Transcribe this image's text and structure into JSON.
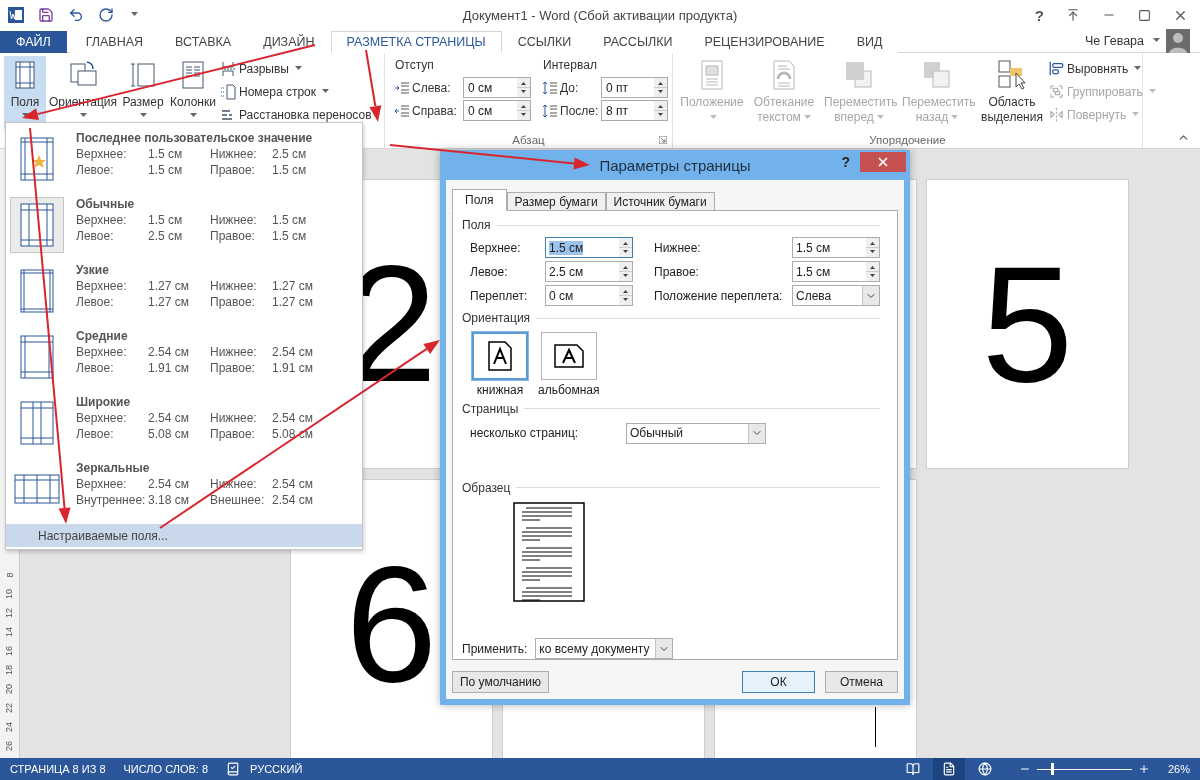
{
  "title_bar": {
    "title": "Документ1 - Word (Сбой активации продукта)",
    "help": "?"
  },
  "tabs": [
    {
      "label": "ФАЙЛ",
      "kind": "file",
      "selected": false
    },
    {
      "label": "ГЛАВНАЯ",
      "kind": "tab",
      "selected": false
    },
    {
      "label": "ВСТАВКА",
      "kind": "tab",
      "selected": false
    },
    {
      "label": "ДИЗАЙН",
      "kind": "tab",
      "selected": false
    },
    {
      "label": "РАЗМЕТКА СТРАНИЦЫ",
      "kind": "tab",
      "selected": true
    },
    {
      "label": "ССЫЛКИ",
      "kind": "tab",
      "selected": false
    },
    {
      "label": "РАССЫЛКИ",
      "kind": "tab",
      "selected": false
    },
    {
      "label": "РЕЦЕНЗИРОВАНИЕ",
      "kind": "tab",
      "selected": false
    },
    {
      "label": "ВИД",
      "kind": "tab",
      "selected": false
    }
  ],
  "user": {
    "name": "Че Гевара"
  },
  "ribbon": {
    "page_setup": {
      "buttons": [
        {
          "label": "Поля",
          "kind": "margins",
          "selected": true
        },
        {
          "label": "Ориентация",
          "kind": "orientation",
          "selected": false
        },
        {
          "label": "Размер",
          "kind": "size",
          "selected": false
        },
        {
          "label": "Колонки",
          "kind": "columns",
          "selected": false
        }
      ],
      "small_buttons": [
        {
          "label": "Разрывы",
          "kind": "breaks",
          "dropdown": true
        },
        {
          "label": "Номера строк",
          "kind": "line_numbers",
          "dropdown": true
        },
        {
          "label": "Расстановка переносов",
          "kind": "hyphenation",
          "dropdown": false
        }
      ]
    },
    "paragraph": {
      "indent_title": "Отступ",
      "spacing_title": "Интервал",
      "indent": [
        {
          "label": "Слева:",
          "value": "0 см"
        },
        {
          "label": "Справа:",
          "value": "0 см"
        }
      ],
      "spacing": [
        {
          "label": "До:",
          "value": "0 пт"
        },
        {
          "label": "После:",
          "value": "8 пт"
        }
      ],
      "group_label": "Абзац"
    },
    "arrange": {
      "buttons": [
        {
          "label": "Положение",
          "kind": "position",
          "disabled": true,
          "dropdown": true
        },
        {
          "label": "Обтекание текстом",
          "kind": "wrap",
          "disabled": true,
          "dropdown": true
        },
        {
          "label": "Переместить вперед",
          "kind": "forward",
          "disabled": true,
          "dropdown": true
        },
        {
          "label": "Переместить назад",
          "kind": "backward",
          "disabled": true,
          "dropdown": true
        },
        {
          "label": "Область выделения",
          "kind": "selection_pane",
          "disabled": false,
          "dropdown": false
        }
      ],
      "small_buttons": [
        {
          "label": "Выровнять",
          "kind": "align",
          "disabled": false
        },
        {
          "label": "Группировать",
          "kind": "group",
          "disabled": true
        },
        {
          "label": "Повернуть",
          "kind": "rotate",
          "disabled": true
        }
      ],
      "group_label": "Упорядочение"
    }
  },
  "document": {
    "ruler_numbers": [
      "8",
      "10",
      "12",
      "14",
      "16",
      "18",
      "20",
      "22",
      "24",
      "26"
    ],
    "pages": [
      {
        "kind": "numbered",
        "number": "2"
      },
      {
        "kind": "blank"
      },
      {
        "kind": "numbered",
        "number": "5"
      },
      {
        "kind": "numbered",
        "number": "6"
      },
      {
        "kind": "blank"
      },
      {
        "kind": "cursor"
      }
    ]
  },
  "margins_menu": {
    "presets": [
      {
        "name": "Последнее пользовательское значение",
        "kind": "last",
        "selected": false,
        "rows": [
          [
            "Верхнее:",
            "1.5 см",
            "Нижнее:",
            "2.5 см"
          ],
          [
            "Левое:",
            "1.5 см",
            "Правое:",
            "1.5 см"
          ]
        ]
      },
      {
        "name": "Обычные",
        "kind": "normal",
        "selected": true,
        "rows": [
          [
            "Верхнее:",
            "1.5 см",
            "Нижнее:",
            "1.5 см"
          ],
          [
            "Левое:",
            "2.5 см",
            "Правое:",
            "1.5 см"
          ]
        ]
      },
      {
        "name": "Узкие",
        "kind": "narrow",
        "selected": false,
        "rows": [
          [
            "Верхнее:",
            "1.27 см",
            "Нижнее:",
            "1.27 см"
          ],
          [
            "Левое:",
            "1.27 см",
            "Правое:",
            "1.27 см"
          ]
        ]
      },
      {
        "name": "Средние",
        "kind": "moderate",
        "selected": false,
        "rows": [
          [
            "Верхнее:",
            "2.54 см",
            "Нижнее:",
            "2.54 см"
          ],
          [
            "Левое:",
            "1.91 см",
            "Правое:",
            "1.91 см"
          ]
        ]
      },
      {
        "name": "Широкие",
        "kind": "wide",
        "selected": false,
        "rows": [
          [
            "Верхнее:",
            "2.54 см",
            "Нижнее:",
            "2.54 см"
          ],
          [
            "Левое:",
            "5.08 см",
            "Правое:",
            "5.08 см"
          ]
        ]
      },
      {
        "name": "Зеркальные",
        "kind": "mirrored",
        "selected": false,
        "rows": [
          [
            "Верхнее:",
            "2.54 см",
            "Нижнее:",
            "2.54 см"
          ],
          [
            "Внутреннее:",
            "3.18 см",
            "Внешнее:",
            "2.54 см"
          ]
        ]
      }
    ],
    "custom": {
      "label": "Настраиваемые поля...",
      "highlighted": true
    }
  },
  "dialog": {
    "title": "Параметры страницы",
    "tabs": [
      {
        "label": "Поля",
        "selected": true
      },
      {
        "label": "Размер бумаги",
        "selected": false
      },
      {
        "label": "Источник бумаги",
        "selected": false
      }
    ],
    "margins": {
      "title": "Поля",
      "fields": [
        {
          "label": "Верхнее:",
          "value": "1.5 см",
          "kind": "spin",
          "focused": true
        },
        {
          "label": "Нижнее:",
          "value": "1.5 см",
          "kind": "spin",
          "focused": false
        },
        {
          "label": "Левое:",
          "value": "2.5 см",
          "kind": "spin",
          "focused": false
        },
        {
          "label": "Правое:",
          "value": "1.5 см",
          "kind": "spin",
          "focused": false
        },
        {
          "label": "Переплет:",
          "value": "0 см",
          "kind": "spin",
          "focused": false
        },
        {
          "label": "Положение переплета:",
          "value": "Слева",
          "kind": "select",
          "focused": false
        }
      ]
    },
    "orientation": {
      "title": "Ориентация",
      "options": [
        {
          "label": "книжная",
          "kind": "portrait",
          "selected": true
        },
        {
          "label": "альбомная",
          "kind": "landscape",
          "selected": false
        }
      ]
    },
    "pages": {
      "title": "Страницы",
      "label": "несколько страниц:",
      "value": "Обычный"
    },
    "preview": {
      "title": "Образец"
    },
    "apply": {
      "label": "Применить:",
      "value": "ко всему документу"
    },
    "buttons": [
      {
        "label": "По умолчанию",
        "kind": "secondary"
      },
      {
        "label": "ОК",
        "kind": "default"
      },
      {
        "label": "Отмена",
        "kind": "secondary"
      }
    ]
  },
  "status_bar": {
    "page": "СТРАНИЦА 8 ИЗ 8",
    "words": "ЧИСЛО СЛОВ: 8",
    "language": "РУССКИЙ",
    "views": [
      {
        "kind": "read",
        "selected": false
      },
      {
        "kind": "print",
        "selected": true
      },
      {
        "kind": "web",
        "selected": false
      }
    ],
    "zoom": {
      "level": 0.16,
      "reading": "26%"
    }
  }
}
